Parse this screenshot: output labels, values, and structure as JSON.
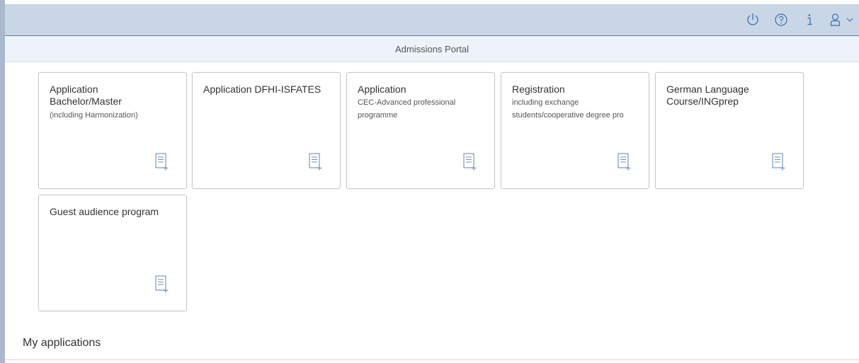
{
  "shell": {
    "actions": [
      {
        "name": "power-icon"
      },
      {
        "name": "help-icon"
      },
      {
        "name": "info-icon"
      },
      {
        "name": "user-icon"
      }
    ],
    "icon_color": "#3a6fb0"
  },
  "subheader": {
    "title": "Admissions Portal"
  },
  "tiles": [
    {
      "title": "Application Bachelor/Master",
      "subtitle": "(including Harmonization)",
      "icon": "add-document-icon"
    },
    {
      "title": "Application DFHI-ISFATES",
      "subtitle": "",
      "icon": "add-document-icon"
    },
    {
      "title": "Application",
      "subtitle": "CEC-Advanced professional programme",
      "icon": "add-document-icon"
    },
    {
      "title": "Registration",
      "subtitle": "including exchange students/cooperative degree pro",
      "icon": "add-document-icon"
    },
    {
      "title": "German Language Course/INGprep",
      "subtitle": "",
      "icon": "add-document-icon"
    },
    {
      "title": "Guest audience program",
      "subtitle": "",
      "icon": "add-document-icon"
    }
  ],
  "section": {
    "title": "My applications"
  }
}
